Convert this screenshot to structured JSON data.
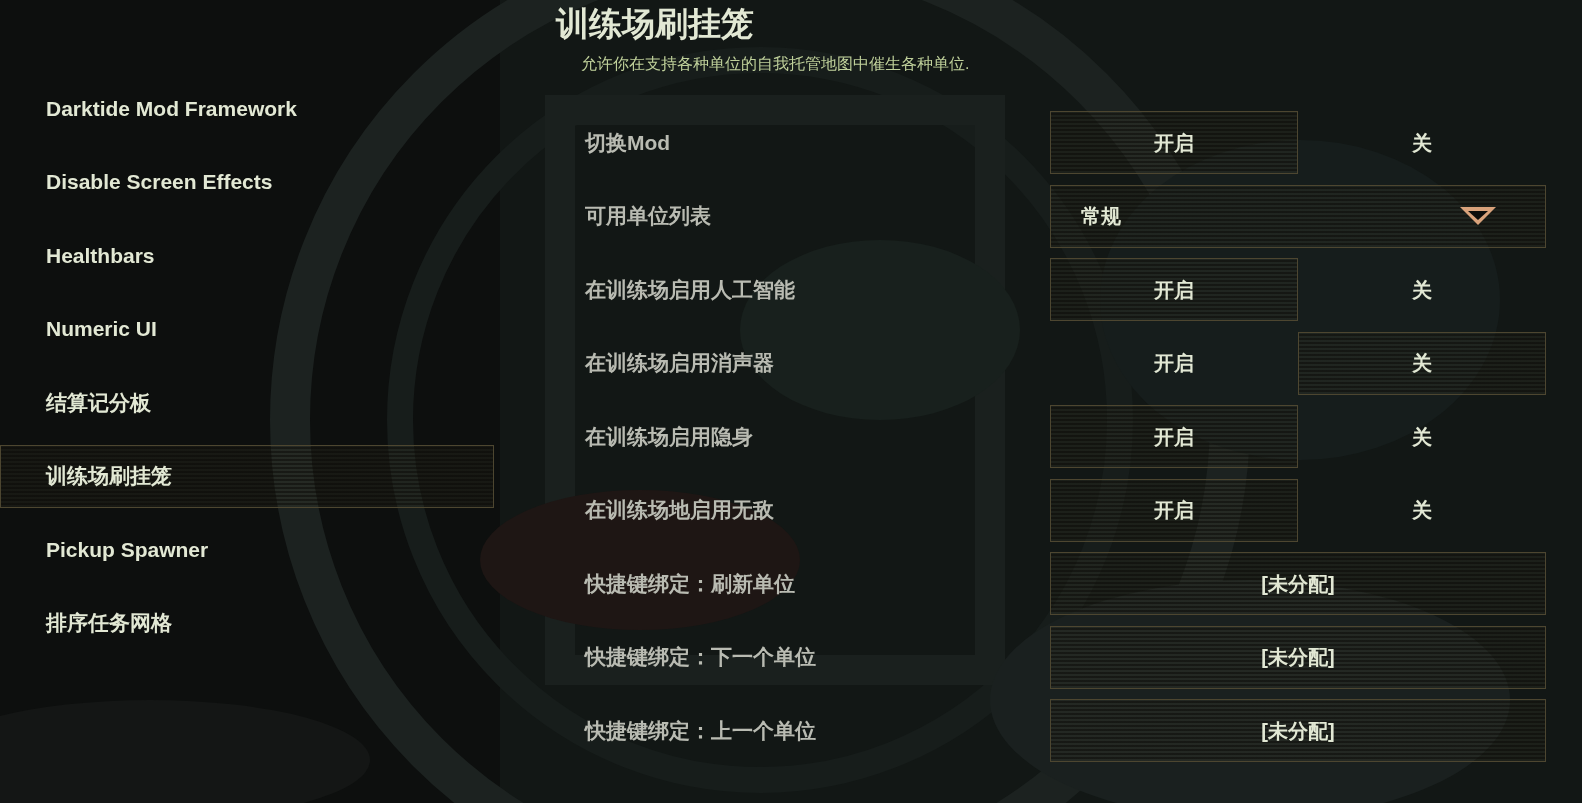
{
  "sidebar": {
    "items": [
      {
        "label": "Darktide Mod Framework",
        "selected": false
      },
      {
        "label": "Disable Screen Effects",
        "selected": false
      },
      {
        "label": "Healthbars",
        "selected": false
      },
      {
        "label": "Numeric UI",
        "selected": false
      },
      {
        "label": "结算记分板",
        "selected": false
      },
      {
        "label": "训练场刷挂笼",
        "selected": true
      },
      {
        "label": "Pickup Spawner",
        "selected": false
      },
      {
        "label": "排序任务网格",
        "selected": false
      }
    ]
  },
  "panel": {
    "title": "训练场刷挂笼",
    "description": "允许你在支持各种单位的自我托管地图中催生各种单位.",
    "settings": [
      {
        "kind": "toggle",
        "label": "切换Mod",
        "options": [
          {
            "label": "开启",
            "selected": true
          },
          {
            "label": "关",
            "selected": false
          }
        ]
      },
      {
        "kind": "dropdown",
        "label": "可用单位列表",
        "value": "常规"
      },
      {
        "kind": "toggle",
        "label": "在训练场启用人工智能",
        "options": [
          {
            "label": "开启",
            "selected": true
          },
          {
            "label": "关",
            "selected": false
          }
        ]
      },
      {
        "kind": "toggle",
        "label": "在训练场启用消声器",
        "options": [
          {
            "label": "开启",
            "selected": false
          },
          {
            "label": "关",
            "selected": true
          }
        ]
      },
      {
        "kind": "toggle",
        "label": "在训练场启用隐身",
        "options": [
          {
            "label": "开启",
            "selected": true
          },
          {
            "label": "关",
            "selected": false
          }
        ]
      },
      {
        "kind": "toggle",
        "label": "在训练场地启用无敌",
        "options": [
          {
            "label": "开启",
            "selected": true
          },
          {
            "label": "关",
            "selected": false
          }
        ]
      },
      {
        "kind": "keybind",
        "label": "快捷键绑定：刷新单位",
        "value": "[未分配]"
      },
      {
        "kind": "keybind",
        "label": "快捷键绑定：下一个单位",
        "value": "[未分配]"
      },
      {
        "kind": "keybind",
        "label": "快捷键绑定：上一个单位",
        "value": "[未分配]"
      }
    ]
  }
}
